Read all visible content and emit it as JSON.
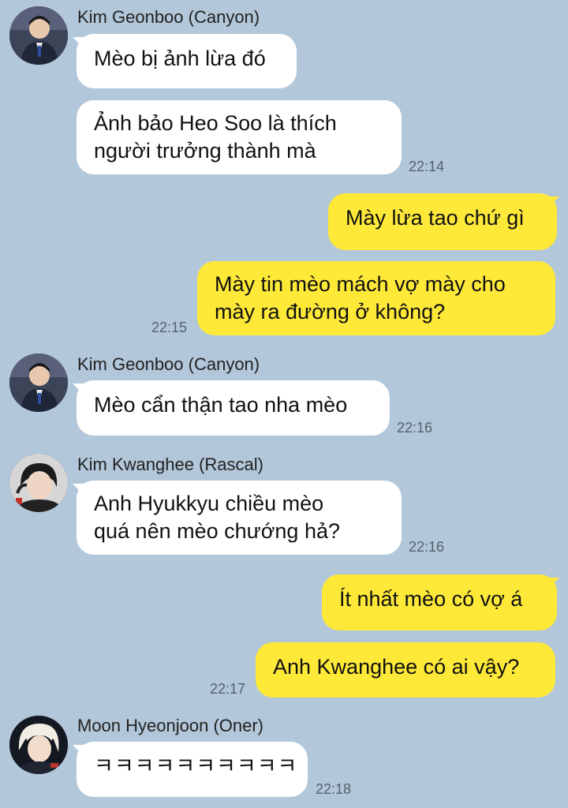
{
  "colors": {
    "background": "#b2c7d9",
    "incoming_bubble": "#ffffff",
    "outgoing_bubble": "#fee939"
  },
  "messages": {
    "g1": {
      "sender": "Kim Geonboo (Canyon)",
      "avatar_icon": "user-avatar-icon",
      "b1": "Mèo bị ảnh lừa đó",
      "b2_line1": "Ảnh bảo Heo Soo là thích",
      "b2_line2": "người trưởng thành mà",
      "time": "22:14"
    },
    "o1": {
      "b1": "Mày lừa tao chứ gì",
      "b2_line1": "Mày tin mèo mách vợ mày cho",
      "b2_line2": "mày ra đường ở không?",
      "time": "22:15"
    },
    "g2": {
      "sender": "Kim Geonboo (Canyon)",
      "b1": "Mèo cẩn thận tao nha mèo",
      "time": "22:16"
    },
    "g3": {
      "sender": "Kim Kwanghee (Rascal)",
      "b1_line1": "Anh Hyukkyu chiều mèo",
      "b1_line2": "quá nên mèo chướng hả?",
      "time": "22:16"
    },
    "o2": {
      "b1": "Ít nhất mèo có vợ á",
      "b2": "Anh Kwanghee có ai vậy?",
      "time": "22:17"
    },
    "g4": {
      "sender": "Moon Hyeonjoon (Oner)",
      "b1": "ㅋㅋㅋㅋㅋㅋㅋㅋㅋㅋ",
      "time": "22:18"
    }
  }
}
